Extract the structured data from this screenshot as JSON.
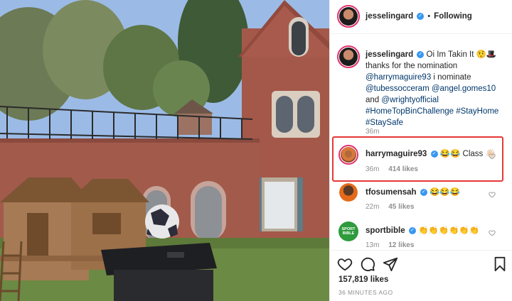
{
  "header": {
    "username": "jesselingard",
    "separator": "•",
    "follow_state": "Following"
  },
  "caption": {
    "username": "jesselingard",
    "text_line1": "Oi Im Takin It 🤨🎩",
    "text_line2": "thanks for the nomination",
    "mention1": "@harrymaguire93",
    "text_nominate": " i nominate",
    "mention2": "@tubessocceram",
    "mention3": "@angel.gomes10",
    "text_and": "and ",
    "mention4": "@wrightyofficial",
    "hashtag1": "#HomeTopBinChallenge",
    "hashtag2": "#StayHome",
    "hashtag3": "#StaySafe",
    "time": "36m"
  },
  "comments": [
    {
      "username": "harrymaguire93",
      "verified": true,
      "text": "😂😂 Class 👋🏻",
      "time": "36m",
      "likes": "414 likes"
    },
    {
      "username": "tfosumensah",
      "verified": true,
      "text": "😂😂😂",
      "time": "22m",
      "likes": "45 likes"
    },
    {
      "username": "sportbible",
      "verified": true,
      "text": "👏👏👏👏👏👏",
      "time": "13m",
      "likes": "12 likes"
    }
  ],
  "avatars": {
    "sportbible_badge": "SPORT BIBLE"
  },
  "footer": {
    "likes_count": "157,819 likes",
    "time_ago": "36 MINUTES AGO"
  },
  "colors": {
    "highlight_border": "#e53935",
    "verified_blue": "#3897f0",
    "link_blue": "#00376b",
    "meta_gray": "#8e8e8e",
    "story_ring": "#e1306c"
  },
  "icons": {
    "like": "heart-icon",
    "comment": "comment-icon",
    "share": "paper-plane-icon",
    "save": "bookmark-icon",
    "comment_like": "heart-icon"
  }
}
